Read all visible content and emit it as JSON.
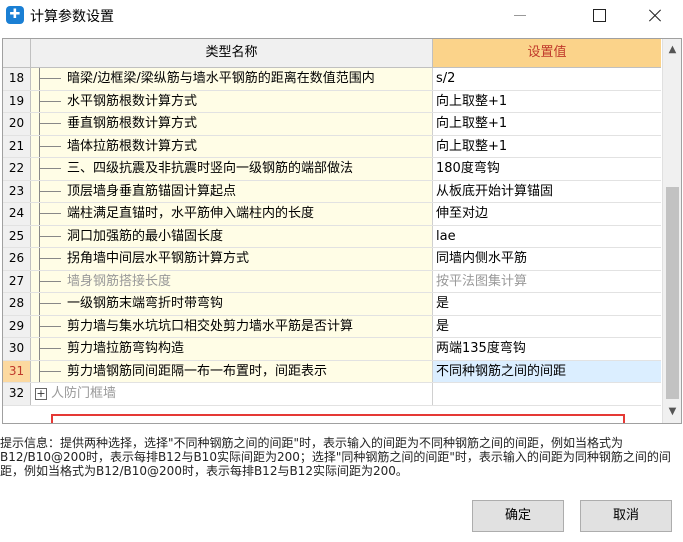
{
  "window": {
    "title": "计算参数设置"
  },
  "table": {
    "header_name": "类型名称",
    "header_value": "设置值",
    "rows": [
      {
        "num": "18",
        "name": "暗梁/边框梁/梁纵筋与墙水平钢筋的距离在数值范围内",
        "value": "s/2",
        "state": "normal"
      },
      {
        "num": "19",
        "name": "水平钢筋根数计算方式",
        "value": "向上取整+1",
        "state": "normal"
      },
      {
        "num": "20",
        "name": "垂直钢筋根数计算方式",
        "value": "向上取整+1",
        "state": "normal"
      },
      {
        "num": "21",
        "name": "墙体拉筋根数计算方式",
        "value": "向上取整+1",
        "state": "normal"
      },
      {
        "num": "22",
        "name": "三、四级抗震及非抗震时竖向一级钢筋的端部做法",
        "value": "180度弯钩",
        "state": "normal"
      },
      {
        "num": "23",
        "name": "顶层墙身垂直筋锚固计算起点",
        "value": "从板底开始计算锚固",
        "state": "normal"
      },
      {
        "num": "24",
        "name": "端柱满足直锚时，水平筋伸入端柱内的长度",
        "value": "伸至对边",
        "state": "normal"
      },
      {
        "num": "25",
        "name": "洞口加强筋的最小锚固长度",
        "value": "lae",
        "state": "normal"
      },
      {
        "num": "26",
        "name": "拐角墙中间层水平钢筋计算方式",
        "value": "同墙内侧水平筋",
        "state": "normal"
      },
      {
        "num": "27",
        "name": "墙身钢筋搭接长度",
        "value": "按平法图集计算",
        "state": "disabled"
      },
      {
        "num": "28",
        "name": "一级钢筋末端弯折时带弯钩",
        "value": "是",
        "state": "normal"
      },
      {
        "num": "29",
        "name": "剪力墙与集水坑坑口相交处剪力墙水平筋是否计算",
        "value": "是",
        "state": "normal"
      },
      {
        "num": "30",
        "name": "剪力墙拉筋弯钩构造",
        "value": "两端135度弯钩",
        "state": "normal"
      },
      {
        "num": "31",
        "name": "剪力墙钢筋同间距隔一布一布置时，间距表示",
        "value": "不同种钢筋之间的间距",
        "state": "selected"
      }
    ],
    "group_row": {
      "num": "32",
      "expander": "+",
      "name": "人防门框墙"
    }
  },
  "tip": {
    "text": "提示信息：提供两种选择，选择\"不同种钢筋之间的间距\"时，表示输入的间距为不同种钢筋之间的间距，例如当格式为B12/B10@200时，表示每排B12与B10实际间距为200；选择\"同种钢筋之间的间距\"时，表示输入的间距为同种钢筋之间的间距，例如当格式为B12/B10@200时，表示每排B12与B12实际间距为200。"
  },
  "buttons": {
    "ok": "确定",
    "cancel": "取消"
  },
  "colors": {
    "header_value_bg": "#fbd38a",
    "name_bg": "#fffde6",
    "highlight_border": "#e53935",
    "selected_value_bg": "#dbeeff"
  }
}
